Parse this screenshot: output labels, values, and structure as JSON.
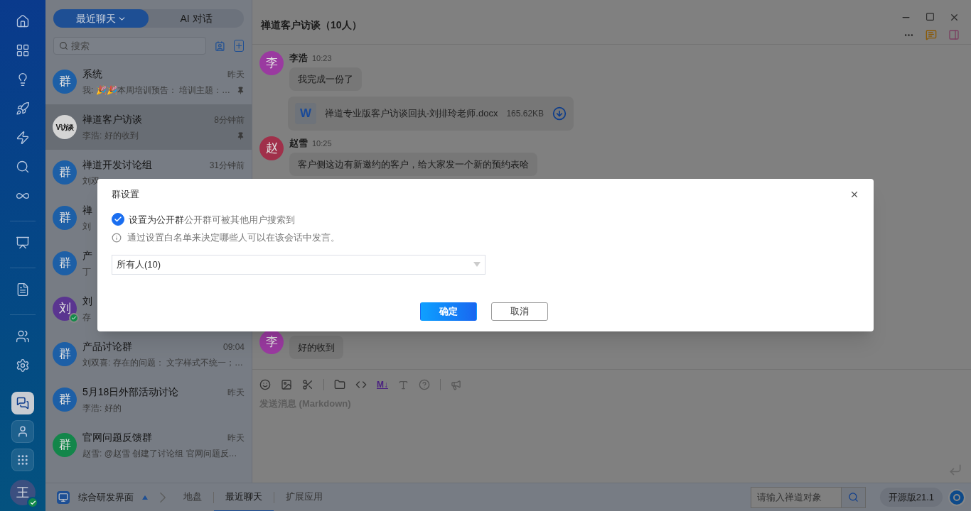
{
  "rail": {
    "items": [
      {
        "kind": "nav",
        "selected": false
      },
      {
        "kind": "nav",
        "selected": false
      },
      {
        "kind": "nav",
        "selected": false
      },
      {
        "kind": "nav",
        "selected": false
      },
      {
        "kind": "nav",
        "selected": false
      },
      {
        "kind": "nav",
        "selected": false
      },
      {
        "kind": "nav",
        "selected": false
      },
      {
        "kind": "nav",
        "selected": false
      },
      {
        "kind": "nav",
        "selected": false
      },
      {
        "kind": "nav",
        "selected": false
      },
      {
        "kind": "nav",
        "selected": false
      },
      {
        "kind": "dock",
        "selected": true
      },
      {
        "kind": "dock",
        "selected": false
      },
      {
        "kind": "dock",
        "selected": false
      }
    ],
    "user": {
      "avatar_text": "王",
      "online": true
    }
  },
  "chat_list": {
    "tabs": [
      {
        "label": "最近聊天",
        "selected": true,
        "dropdown": true
      },
      {
        "label": "AI 对话",
        "selected": false,
        "dropdown": false
      }
    ],
    "search": {
      "placeholder": "搜索"
    },
    "items": [
      {
        "kind": "text",
        "avatar_text": "群",
        "color": "#1d5fa6",
        "name": "系统",
        "time": "昨天",
        "preview": "我: 🎉🎉本周培训预告： 培训主题：…",
        "pinned": true,
        "online": false,
        "selected": false
      },
      {
        "kind": "logo",
        "avatar_text": "V访谈",
        "color": "#d4d4d4",
        "name": "禅道客户访谈",
        "time": "8分钟前",
        "preview": "李浩: 好的收到",
        "pinned": true,
        "online": false,
        "selected": true
      },
      {
        "kind": "text",
        "avatar_text": "群",
        "color": "#1d5fa6",
        "name": "禅道开发讨论组",
        "time": "31分钟前",
        "preview": "刘双",
        "pinned": false,
        "online": false,
        "selected": false
      },
      {
        "kind": "text",
        "avatar_text": "群",
        "color": "#1d5fa6",
        "name": "禅",
        "preview": "刘",
        "pinned": false,
        "online": false,
        "selected": false
      },
      {
        "kind": "text",
        "avatar_text": "群",
        "color": "#1d5fa6",
        "name": "产",
        "preview": "丁",
        "pinned": false,
        "online": false,
        "selected": false
      },
      {
        "kind": "text",
        "avatar_text": "刘",
        "color": "#5a3590",
        "name": "刘",
        "preview": "存",
        "pinned": false,
        "online": true,
        "selected": false
      },
      {
        "kind": "text",
        "avatar_text": "群",
        "color": "#1d5fa6",
        "name": "产品讨论群",
        "time": "09:04",
        "preview": "刘双喜: 存在的问题： 文字样式不统一；…",
        "pinned": false,
        "online": false,
        "selected": false
      },
      {
        "kind": "text",
        "avatar_text": "群",
        "color": "#1d5fa6",
        "name": "5月18日外部活动讨论",
        "time": "昨天",
        "preview": "李浩: 好的",
        "pinned": false,
        "online": false,
        "selected": false
      },
      {
        "kind": "text",
        "avatar_text": "群",
        "color": "#13864a",
        "name": "官网问题反馈群",
        "time": "昨天",
        "preview": "赵雪: @赵雪 创建了讨论组 官网问题反…",
        "pinned": false,
        "online": false,
        "selected": false
      }
    ]
  },
  "chat": {
    "title": "禅道客户访谈（10人）",
    "messages": [
      {
        "kind": "text",
        "author": "李浩",
        "avatar_text": "李",
        "color": "#9a3aa0",
        "time": "10:23",
        "text": "我完成一份了"
      },
      {
        "kind": "file",
        "file_icon": "W",
        "file_name": "禅道专业版客户访谈回执-刘排玲老师.docx",
        "size": "165.62KB"
      },
      {
        "kind": "text",
        "author": "赵雪",
        "avatar_text": "赵",
        "color": "#a0304a",
        "time": "10:25",
        "text": "客户侧这边有新邀约的客户，给大家发一个新的预约表哈"
      }
    ],
    "last_message": {
      "avatar_text": "李",
      "color": "#9a3aa0",
      "text": "好的收到"
    },
    "toolbar_markdown": "M↓",
    "input": {
      "placeholder": "发送消息 (Markdown)"
    }
  },
  "bottom_bar": {
    "workspace": "综合研发界面",
    "tabs": [
      {
        "label": "地盘",
        "selected": false
      },
      {
        "label": "最近聊天",
        "selected": true
      },
      {
        "label": "扩展应用",
        "selected": false
      }
    ],
    "search": {
      "placeholder": "请输入禅道对象"
    },
    "version": "开源版21.1"
  },
  "dialog": {
    "title": "群设置",
    "public": {
      "checked": true,
      "label": "设置为公开群",
      "hint": "公开群可被其他用户搜索到"
    },
    "info": "通过设置白名单来决定哪些人可以在该会话中发言。",
    "select": {
      "value": "所有人(10)"
    },
    "buttons": [
      {
        "kind": "primary",
        "label": "确定"
      },
      {
        "kind": "secondary",
        "label": "取消"
      }
    ]
  }
}
